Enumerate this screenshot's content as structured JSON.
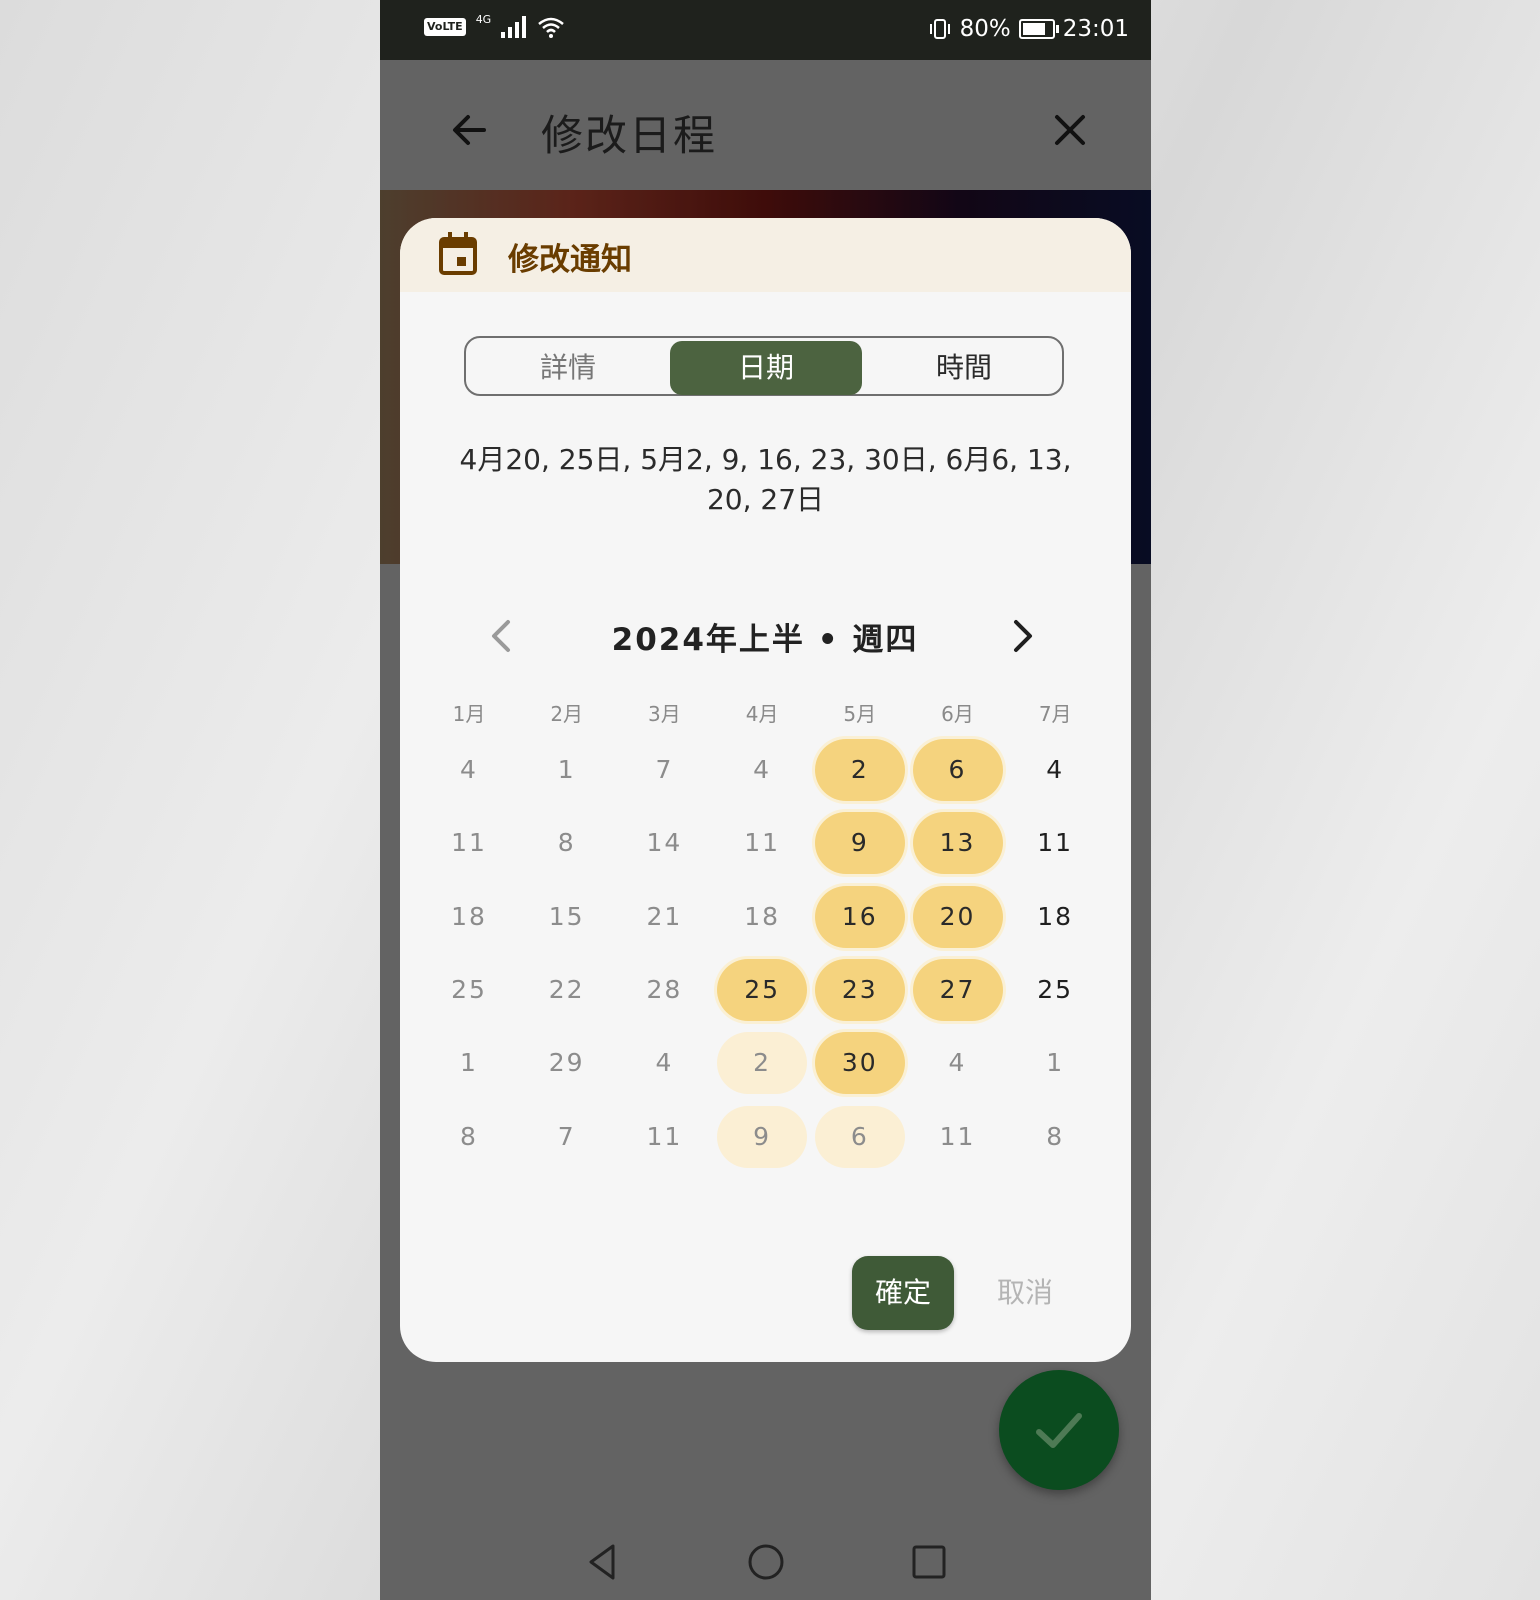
{
  "status_bar": {
    "volte": "VoLTE",
    "network": "4G",
    "battery_pct_text": "80%",
    "battery_level": 0.8,
    "time": "23:01"
  },
  "app_bar": {
    "title": "修改日程"
  },
  "dialog": {
    "title": "修改通知",
    "tabs": [
      {
        "label": "詳情",
        "selected": false
      },
      {
        "label": "日期",
        "selected": true
      },
      {
        "label": "時間",
        "selected": false
      }
    ],
    "summary_line1": "4月20, 25日, 5月2, 9, 16, 23, 30日, 6月6, 13,",
    "summary_line2": "20, 27日",
    "period": "2024年上半 • 週四",
    "months": [
      "1月",
      "2月",
      "3月",
      "4月",
      "5月",
      "6月",
      "7月"
    ],
    "columns": [
      {
        "days": [
          "4",
          "11",
          "18",
          "25",
          "1",
          "8"
        ],
        "states": [
          "muted",
          "muted",
          "muted",
          "muted",
          "muted",
          "muted"
        ]
      },
      {
        "days": [
          "1",
          "8",
          "15",
          "22",
          "29",
          "7"
        ],
        "states": [
          "muted",
          "muted",
          "muted",
          "muted",
          "muted",
          "muted"
        ]
      },
      {
        "days": [
          "7",
          "14",
          "21",
          "28",
          "4",
          "11"
        ],
        "states": [
          "muted",
          "muted",
          "muted",
          "muted",
          "muted",
          "muted"
        ]
      },
      {
        "days": [
          "4",
          "11",
          "18",
          "25",
          "2",
          "9"
        ],
        "states": [
          "muted",
          "muted",
          "muted",
          "sel",
          "light",
          "light"
        ]
      },
      {
        "days": [
          "2",
          "9",
          "16",
          "23",
          "30",
          "6"
        ],
        "states": [
          "sel",
          "sel",
          "sel",
          "sel",
          "sel",
          "light"
        ]
      },
      {
        "days": [
          "6",
          "13",
          "20",
          "27",
          "4",
          "11"
        ],
        "states": [
          "sel",
          "sel",
          "sel",
          "sel",
          "muted",
          "muted"
        ]
      },
      {
        "days": [
          "4",
          "11",
          "18",
          "25",
          "1",
          "8"
        ],
        "states": [
          "dark",
          "dark",
          "dark",
          "dark",
          "muted",
          "muted"
        ]
      }
    ],
    "confirm_label": "確定",
    "cancel_label": "取消"
  },
  "colors": {
    "accent": "#4c6340",
    "selected_day": "#f5d37e",
    "fab": "#0b4c1f",
    "title_brown": "#6a3d00"
  },
  "icons": [
    "back-arrow-icon",
    "close-icon",
    "calendar-icon",
    "chevron-left-icon",
    "chevron-right-icon",
    "check-icon",
    "nav-back-icon",
    "nav-home-icon",
    "nav-recents-icon"
  ]
}
